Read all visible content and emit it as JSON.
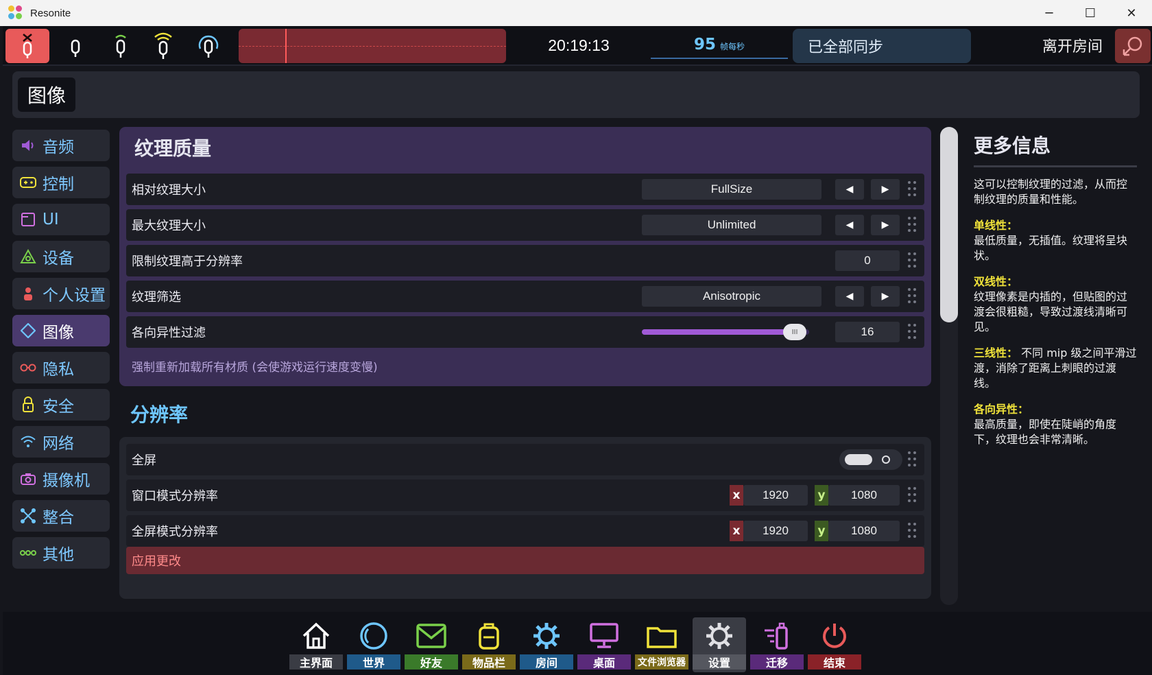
{
  "window": {
    "title": "Resonite",
    "minimize": "─",
    "maximize": "☐",
    "close": "✕"
  },
  "topbar": {
    "clock": "20:19:13",
    "fps_value": "95",
    "fps_unit": "帧每秒",
    "sync_status": "已全部同步",
    "leave_label": "离开房间"
  },
  "header": {
    "title": "图像"
  },
  "sidebar": {
    "items": [
      {
        "label": "音频",
        "icon": "speaker-icon"
      },
      {
        "label": "控制",
        "icon": "gamepad-icon"
      },
      {
        "label": "UI",
        "icon": "window-icon"
      },
      {
        "label": "设备",
        "icon": "device-icon"
      },
      {
        "label": "个人设置",
        "icon": "person-icon"
      },
      {
        "label": "图像",
        "icon": "diamond-icon"
      },
      {
        "label": "隐私",
        "icon": "glasses-icon"
      },
      {
        "label": "安全",
        "icon": "lock-icon"
      },
      {
        "label": "网络",
        "icon": "wifi-icon"
      },
      {
        "label": "摄像机",
        "icon": "camera-icon"
      },
      {
        "label": "整合",
        "icon": "integration-icon"
      },
      {
        "label": "其他",
        "icon": "more-icon"
      }
    ]
  },
  "texture": {
    "title": "纹理质量",
    "relative_size": {
      "label": "相对纹理大小",
      "value": "FullSize"
    },
    "max_size": {
      "label": "最大纹理大小",
      "value": "Unlimited"
    },
    "limit_above_res": {
      "label": "限制纹理高于分辨率",
      "value": "0"
    },
    "filtering": {
      "label": "纹理筛选",
      "value": "Anisotropic"
    },
    "anisotropic": {
      "label": "各向异性过滤",
      "value": "16",
      "slider_fraction": 0.98
    },
    "reload_label": "强制重新加载所有材质 (会使游戏运行速度变慢)"
  },
  "resolution": {
    "title": "分辨率",
    "fullscreen": {
      "label": "全屏"
    },
    "windowed": {
      "label": "窗口模式分辨率",
      "x": "1920",
      "y": "1080"
    },
    "fullscreen_res": {
      "label": "全屏模式分辨率",
      "x": "1920",
      "y": "1080"
    },
    "x_label": "x",
    "y_label": "y",
    "apply_label": "应用更改"
  },
  "info": {
    "title": "更多信息",
    "intro": "这可以控制纹理的过滤，从而控制纹理的质量和性能。",
    "items": [
      {
        "name": "单线性：",
        "text": "最低质量，无插值。纹理将呈块状。"
      },
      {
        "name": "双线性：",
        "text": "纹理像素是内插的，但贴图的过渡会很粗糙，导致过渡线清晰可见。"
      },
      {
        "name": "三线性：",
        "text": " 不同 mip 级之间平滑过渡，消除了距离上刺眼的过渡线。"
      },
      {
        "name": "各向异性：",
        "text": "最高质量，即使在陡峭的角度下，纹理也会非常清晰。"
      }
    ]
  },
  "dock": {
    "items": [
      {
        "label": "主界面",
        "color": "#3a3c44"
      },
      {
        "label": "世界",
        "color": "#1f5a8a"
      },
      {
        "label": "好友",
        "color": "#3a7a2a"
      },
      {
        "label": "物品栏",
        "color": "#7a6a1a"
      },
      {
        "label": "房间",
        "color": "#1f5a8a"
      },
      {
        "label": "桌面",
        "color": "#5a2a7a"
      },
      {
        "label": "文件浏览器",
        "color": "#7a6a1a"
      },
      {
        "label": "设置",
        "color": "#55575f"
      },
      {
        "label": "迁移",
        "color": "#5a2a7a"
      },
      {
        "label": "结束",
        "color": "#8a2228"
      }
    ]
  },
  "colors": {
    "accent_blue": "#6ec6ff",
    "accent_purple": "#a05ad6",
    "highlight_yellow": "#f0e23a",
    "danger_red": "#e85a5a"
  }
}
